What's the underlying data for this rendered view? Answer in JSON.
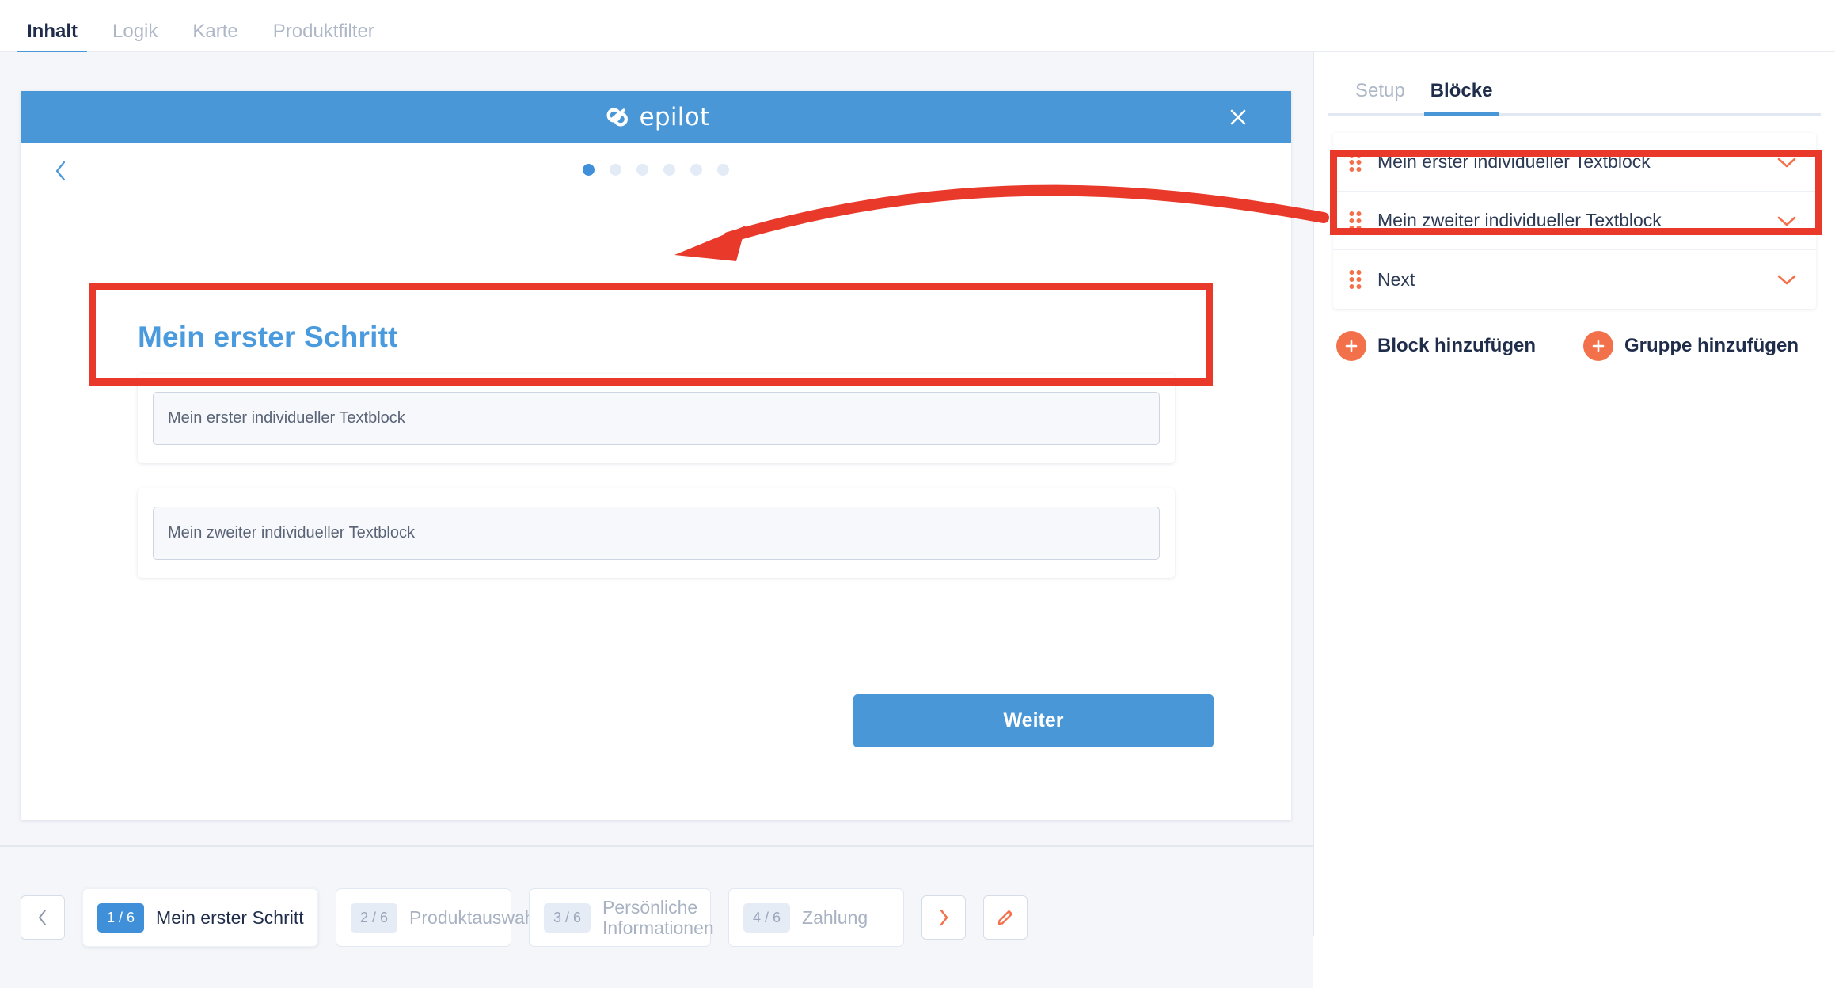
{
  "top_tabs": [
    {
      "label": "Inhalt",
      "active": true
    },
    {
      "label": "Logik",
      "active": false
    },
    {
      "label": "Karte",
      "active": false
    },
    {
      "label": "Produktfilter",
      "active": false
    }
  ],
  "preview": {
    "brand": "epilot",
    "close_icon": "close-icon",
    "back_icon": "chevron-left-icon",
    "dots_total": 6,
    "dots_active_index": 0,
    "step_title": "Mein erster Schritt",
    "blocks": [
      {
        "value": "Mein erster individueller Textblock"
      },
      {
        "value": "Mein zweiter individueller Textblock"
      }
    ],
    "submit_label": "Weiter"
  },
  "step_strip": {
    "prev_icon": "chevron-left-icon",
    "next_icon": "chevron-right-icon",
    "edit_icon": "pencil-icon",
    "steps": [
      {
        "badge": "1 / 6",
        "name": "Mein erster Schritt",
        "active": true
      },
      {
        "badge": "2 / 6",
        "name": "Produktauswahl",
        "active": false
      },
      {
        "badge": "3 / 6",
        "name": "Persönliche Informationen",
        "active": false
      },
      {
        "badge": "4 / 6",
        "name": "Zahlung",
        "active": false
      }
    ]
  },
  "sidebar": {
    "tabs": [
      {
        "label": "Setup",
        "active": false
      },
      {
        "label": "Blöcke",
        "active": true
      }
    ],
    "blocks": [
      {
        "label": "Mein erster individueller Textblock",
        "drag_icon": "drag-handle-icon",
        "chevron": "chevron-down-icon"
      },
      {
        "label": "Mein zweiter individueller Textblock",
        "drag_icon": "drag-handle-icon",
        "chevron": "chevron-down-icon"
      },
      {
        "label": "Next",
        "drag_icon": "drag-handle-icon",
        "chevron": "chevron-down-icon"
      }
    ],
    "add_block_label": "Block hinzufügen",
    "add_group_label": "Gruppe hinzufügen"
  },
  "colors": {
    "brand_blue": "#4a97d8",
    "accent_orange": "#f2714a",
    "annotation_red": "#e8392a",
    "text_dark": "#1f2d4a",
    "text_muted": "#aeb7c6"
  }
}
